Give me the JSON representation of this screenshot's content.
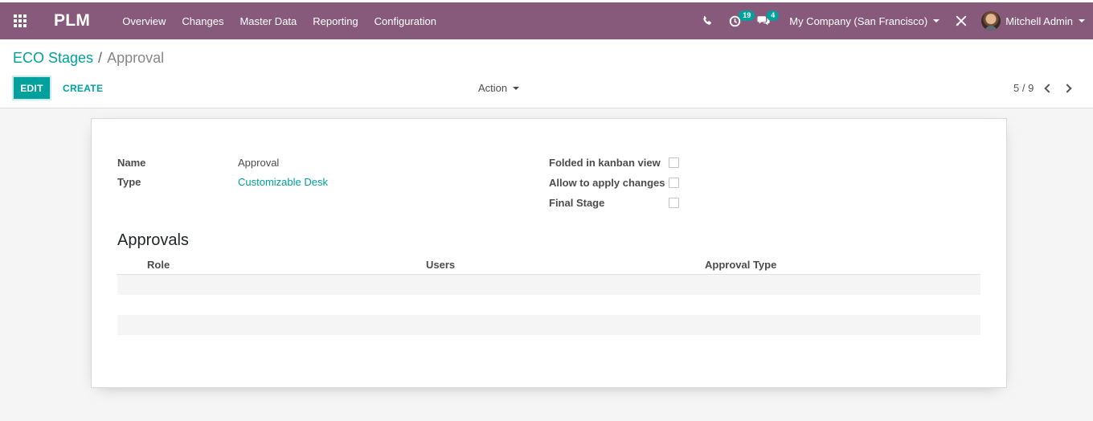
{
  "navbar": {
    "brand": "PLM",
    "menu": [
      "Overview",
      "Changes",
      "Master Data",
      "Reporting",
      "Configuration"
    ],
    "activities_count": "19",
    "messages_count": "4",
    "company": "My Company (San Francisco)",
    "user": "Mitchell Admin",
    "bg_color": "#875a7b"
  },
  "breadcrumb": {
    "parent": "ECO Stages",
    "separator": "/",
    "current": "Approval"
  },
  "toolbar": {
    "edit_label": "EDIT",
    "create_label": "CREATE",
    "action_label": "Action",
    "pager": "5 / 9"
  },
  "form": {
    "name_label": "Name",
    "name_value": "Approval",
    "type_label": "Type",
    "type_value": "Customizable Desk",
    "folded_label": "Folded in kanban view",
    "allow_label": "Allow to apply changes",
    "final_label": "Final Stage",
    "folded_checked": false,
    "allow_checked": false,
    "final_checked": false
  },
  "approvals": {
    "title": "Approvals",
    "columns": [
      "Role",
      "Users",
      "Approval Type"
    ]
  },
  "colors": {
    "accent": "#00a09d"
  }
}
